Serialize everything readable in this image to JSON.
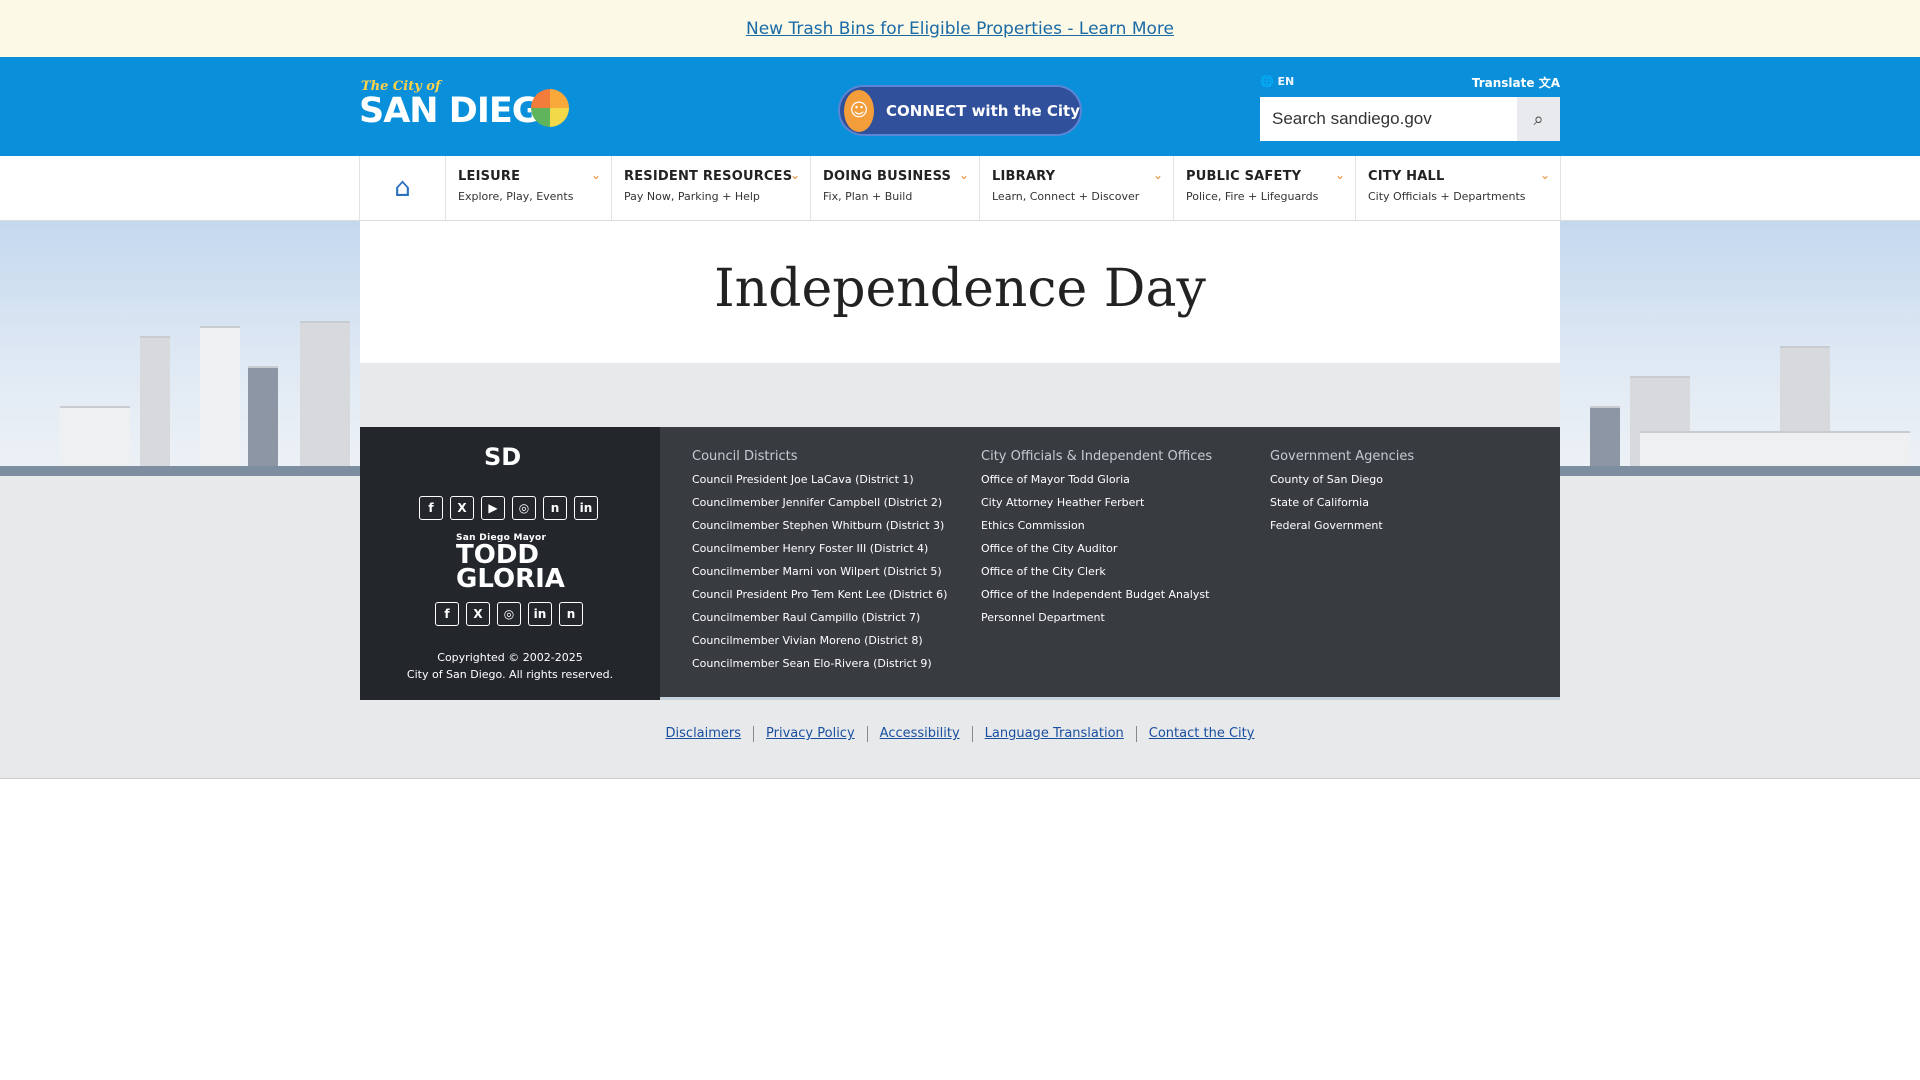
{
  "alert": {
    "text": "New Trash Bins for Eligible Properties - Learn More"
  },
  "header": {
    "logo_small": "The City of",
    "logo_big": "SAN DIEGO",
    "connect_label": "CONNECT with the City",
    "lang": "🌐 EN",
    "translate": "Translate",
    "search_placeholder": "Search sandiego.gov"
  },
  "nav": {
    "items": [
      {
        "title": "LEISURE",
        "sub": "Explore, Play, Events"
      },
      {
        "title": "RESIDENT RESOURCES",
        "sub": "Pay Now, Parking + Help"
      },
      {
        "title": "DOING BUSINESS",
        "sub": "Fix, Plan + Build"
      },
      {
        "title": "LIBRARY",
        "sub": "Learn, Connect + Discover"
      },
      {
        "title": "PUBLIC SAFETY",
        "sub": "Police, Fire + Lifeguards"
      },
      {
        "title": "CITY HALL",
        "sub": "City Officials + Departments"
      }
    ]
  },
  "page": {
    "title": "Independence Day"
  },
  "footer": {
    "sd_logo": "SD",
    "mayor_small": "San Diego Mayor",
    "mayor_name1": "TODD",
    "mayor_name2": "GLORIA",
    "copyright": "Copyrighted © 2002-2025",
    "rights": "City of San Diego. All rights reserved.",
    "social1": [
      "f",
      "X",
      "▶",
      "◎",
      "n",
      "in"
    ],
    "social2": [
      "f",
      "X",
      "◎",
      "in",
      "n"
    ],
    "columns": [
      {
        "title": "Council Districts",
        "links": [
          "Council President Joe LaCava (District 1)",
          "Councilmember Jennifer Campbell (District 2)",
          "Councilmember Stephen Whitburn (District 3)",
          "Councilmember Henry Foster III (District 4)",
          "Councilmember Marni von Wilpert (District 5)",
          "Council President Pro Tem Kent Lee (District 6)",
          "Councilmember Raul Campillo (District 7)",
          "Councilmember Vivian Moreno (District 8)",
          "Councilmember Sean Elo-Rivera (District 9)"
        ]
      },
      {
        "title": "City Officials & Independent Offices",
        "links": [
          "Office of Mayor Todd Gloria",
          "City Attorney Heather Ferbert",
          "Ethics Commission",
          "Office of the City Auditor",
          "Office of the City Clerk",
          "Office of the Independent Budget Analyst",
          "Personnel Department"
        ]
      },
      {
        "title": "Government Agencies",
        "links": [
          "County of San Diego",
          "State of California",
          "Federal Government"
        ]
      }
    ]
  },
  "bottom_links": [
    "Disclaimers",
    "Privacy Policy",
    "Accessibility",
    "Language Translation",
    "Contact the City"
  ],
  "colors": {
    "header_blue": "#0a90da",
    "alert_bg": "#fcf9e7",
    "footer_dark": "#23272b",
    "accent_orange": "#ee8a2a"
  }
}
